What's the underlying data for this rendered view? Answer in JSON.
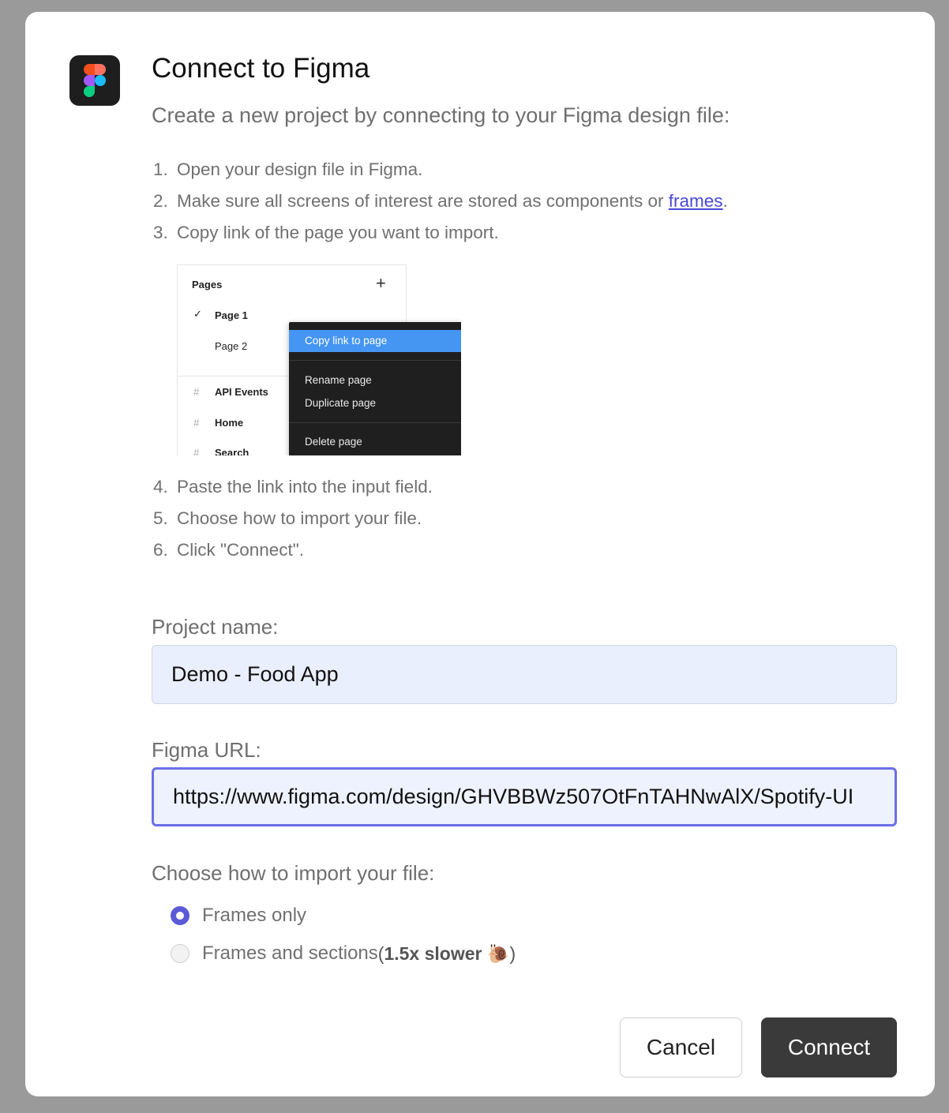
{
  "dialog": {
    "title": "Connect to Figma",
    "subtitle": "Create a new project by connecting to your Figma design file:",
    "app_icon": "figma-logo-icon"
  },
  "steps_part1": [
    {
      "num": "1.",
      "text": "Open your design file in Figma."
    },
    {
      "num": "2.",
      "text": "Make sure all screens of interest are stored as components or ",
      "link": "frames",
      "after": "."
    },
    {
      "num": "3.",
      "text": "Copy link of the page you want to import."
    }
  ],
  "illustration": {
    "pages_header": "Pages",
    "plus": "+",
    "check": "✓",
    "pages": [
      "Page 1",
      "Page 2"
    ],
    "frames": [
      "API Events",
      "Home",
      "Search"
    ],
    "menu": {
      "copy_link": "Copy link to page",
      "rename": "Rename page",
      "duplicate": "Duplicate page",
      "delete": "Delete page"
    }
  },
  "steps_part2": [
    {
      "num": "4.",
      "text": "Paste the link into the input field."
    },
    {
      "num": "5.",
      "text": "Choose how to import your file."
    },
    {
      "num": "6.",
      "text": "Click \"Connect\"."
    }
  ],
  "form": {
    "project_name_label": "Project name:",
    "project_name_value": "Demo - Food App",
    "figma_url_label": "Figma URL:",
    "figma_url_value": "https://www.figma.com/design/GHVBBWz507OtFnTAHNwAlX/Spotify-UI",
    "import_label": "Choose how to import your file:",
    "options": [
      {
        "label": "Frames only",
        "selected": true
      },
      {
        "label": "Frames and sections",
        "extra_open": " (",
        "extra_bold": "1.5x slower",
        "extra_emoji": " 🐌",
        "extra_close": ")",
        "selected": false
      }
    ]
  },
  "buttons": {
    "cancel": "Cancel",
    "connect": "Connect"
  },
  "colors": {
    "accent": "#5b5bd6",
    "link": "#4a48d6",
    "menu_highlight": "#4595f2",
    "primary_button": "#3a3a3a"
  }
}
